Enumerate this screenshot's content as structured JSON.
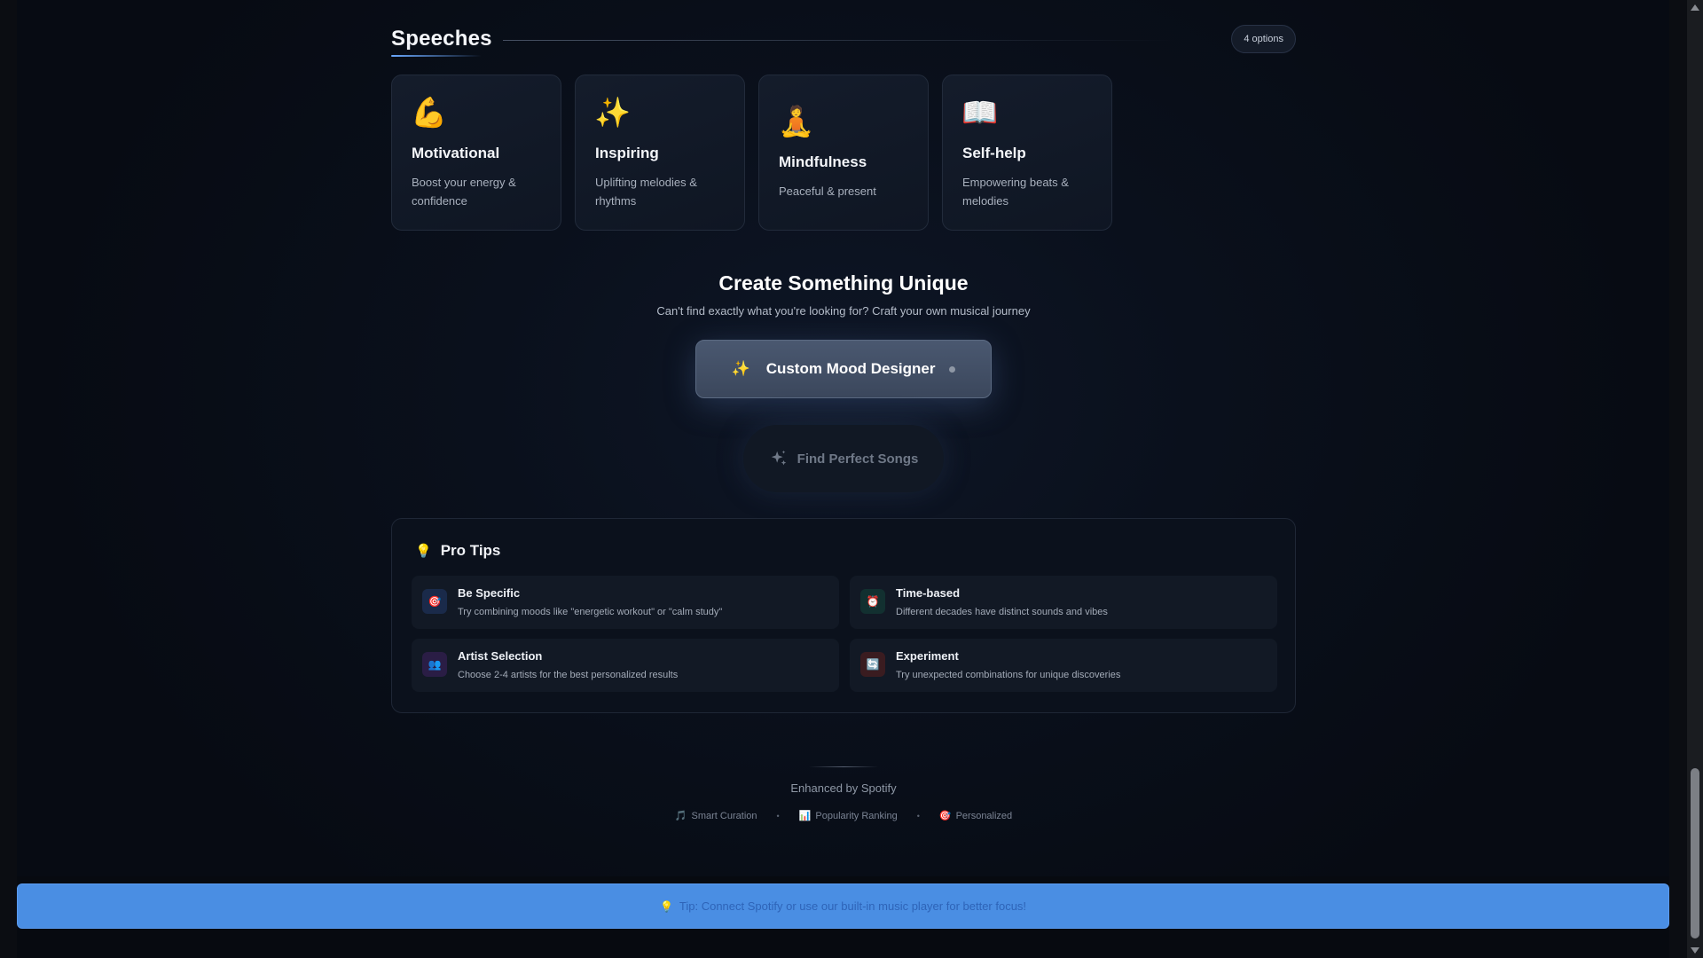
{
  "section": {
    "title": "Speeches",
    "options_badge": "4 options"
  },
  "cards": [
    {
      "emoji": "💪",
      "title": "Motivational",
      "description": "Boost your energy & confidence"
    },
    {
      "emoji": "✨",
      "title": "Inspiring",
      "description": "Uplifting melodies & rhythms"
    },
    {
      "emoji": "🧘",
      "title": "Mindfulness",
      "description": "Peaceful & present"
    },
    {
      "emoji": "📖",
      "title": "Self-help",
      "description": "Empowering beats & melodies"
    }
  ],
  "create": {
    "title": "Create Something Unique",
    "subtitle": "Can't find exactly what you're looking for? Craft your own musical journey",
    "mood_button_icon": "✨",
    "mood_button_label": "Custom Mood Designer",
    "find_button_label": "Find Perfect Songs"
  },
  "pro_tips": {
    "icon": "💡",
    "title": "Pro Tips",
    "items": [
      {
        "icon": "🎯",
        "title": "Be Specific",
        "description": "Try combining moods like \"energetic workout\" or \"calm study\"",
        "color": "#1a2a4a"
      },
      {
        "icon": "⏰",
        "title": "Time-based",
        "description": "Different decades have distinct sounds and vibes",
        "color": "#123030"
      },
      {
        "icon": "👥",
        "title": "Artist Selection",
        "description": "Choose 2-4 artists for the best personalized results",
        "color": "#2a1d45"
      },
      {
        "icon": "🔄",
        "title": "Experiment",
        "description": "Try unexpected combinations for unique discoveries",
        "color": "#3a1c20"
      }
    ]
  },
  "footer": {
    "enhanced": "Enhanced by Spotify",
    "features": [
      {
        "icon": "🎵",
        "label": "Smart Curation"
      },
      {
        "icon": "📊",
        "label": "Popularity Ranking"
      },
      {
        "icon": "🎯",
        "label": "Personalized"
      }
    ],
    "separator": "•"
  },
  "banner": {
    "icon": "💡",
    "text": "Tip: Connect Spotify or use our built-in music player for better focus!"
  },
  "colors": {
    "accent_blue": "#4a8ee3",
    "background": "#0a101c"
  }
}
